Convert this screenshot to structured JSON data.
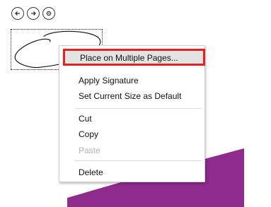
{
  "colors": {
    "accent_purple": "#8f2b8c",
    "highlight_border": "#e8211c",
    "highlight_bg": "#e3e3e3",
    "disabled_text": "#b3b3b3"
  },
  "toolbar": {
    "items": [
      {
        "icon": "arrow-left-circle-icon"
      },
      {
        "icon": "arrow-right-circle-icon"
      },
      {
        "icon": "settings-circle-icon"
      }
    ]
  },
  "context_menu": {
    "items": [
      {
        "label": "Place on Multiple Pages...",
        "highlighted": true,
        "enabled": true
      },
      {
        "label": "Apply Signature",
        "enabled": true
      },
      {
        "label": "Set Current Size as Default",
        "enabled": true
      },
      {
        "label": "Cut",
        "enabled": true
      },
      {
        "label": "Copy",
        "enabled": true
      },
      {
        "label": "Paste",
        "enabled": false
      },
      {
        "label": "Delete",
        "enabled": true
      }
    ]
  }
}
